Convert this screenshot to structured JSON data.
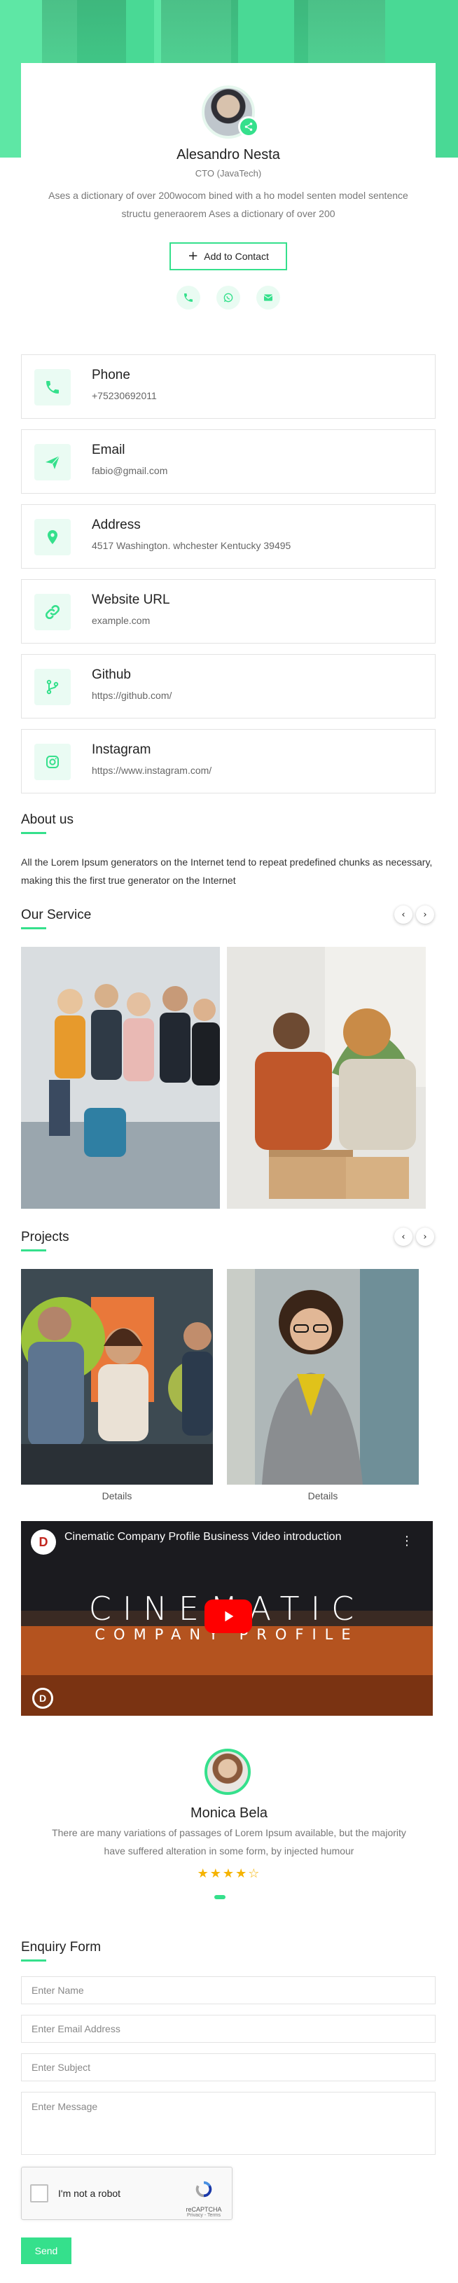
{
  "profile": {
    "name": "Alesandro Nesta",
    "role": "CTO (JavaTech)",
    "bio": "Ases a dictionary of over 200wocom bined with a ho model senten model sentence structu generaorem Ases a dictionary of over 200",
    "add_contact_label": "Add to Contact",
    "quick_actions": [
      "phone-icon",
      "whatsapp-icon",
      "mail-icon"
    ]
  },
  "contacts": [
    {
      "title": "Phone",
      "value": "+75230692011",
      "icon": "phone-icon"
    },
    {
      "title": "Email",
      "value": "fabio@gmail.com",
      "icon": "send-icon"
    },
    {
      "title": "Address",
      "value": "4517 Washington. whchester Kentucky 39495",
      "icon": "map-pin-icon"
    },
    {
      "title": "Website URL",
      "value": "example.com",
      "icon": "link-icon"
    },
    {
      "title": "Github",
      "value": "https://github.com/",
      "icon": "github-icon"
    },
    {
      "title": "Instagram",
      "value": "https://www.instagram.com/",
      "icon": "instagram-icon"
    }
  ],
  "about": {
    "title": "About us",
    "text": "All the Lorem Ipsum generators on the Internet tend to repeat predefined chunks as necessary, making this the first true generator on the Internet"
  },
  "services": {
    "title": "Our Service",
    "prev": "‹",
    "next": "›"
  },
  "projects": {
    "title": "Projects",
    "prev": "‹",
    "next": "›",
    "items": [
      {
        "label": "Details"
      },
      {
        "label": "Details"
      }
    ]
  },
  "video": {
    "title": "Cinematic Company Profile Business Video introduction",
    "line1": "CINEMATIC",
    "line2": "COMPANY PROFILE",
    "menu": "⋮"
  },
  "testimonial": {
    "name": "Monica Bela",
    "quote": "There are many variations of passages of Lorem Ipsum available, but the majority have suffered alteration in some form, by injected humour",
    "rating": 4,
    "max_rating": 5,
    "stars": "★★★★☆"
  },
  "enquiry": {
    "title": "Enquiry Form",
    "name_placeholder": "Enter Name",
    "email_placeholder": "Enter Email Address",
    "subject_placeholder": "Enter Subject",
    "message_placeholder": "Enter Message",
    "captcha_label": "I'm not a robot",
    "captcha_brand": "reCAPTCHA",
    "captcha_terms": "Privacy - Terms",
    "send_label": "Send"
  },
  "colors": {
    "accent": "#35e08c",
    "accent_light": "#eafbf3"
  }
}
